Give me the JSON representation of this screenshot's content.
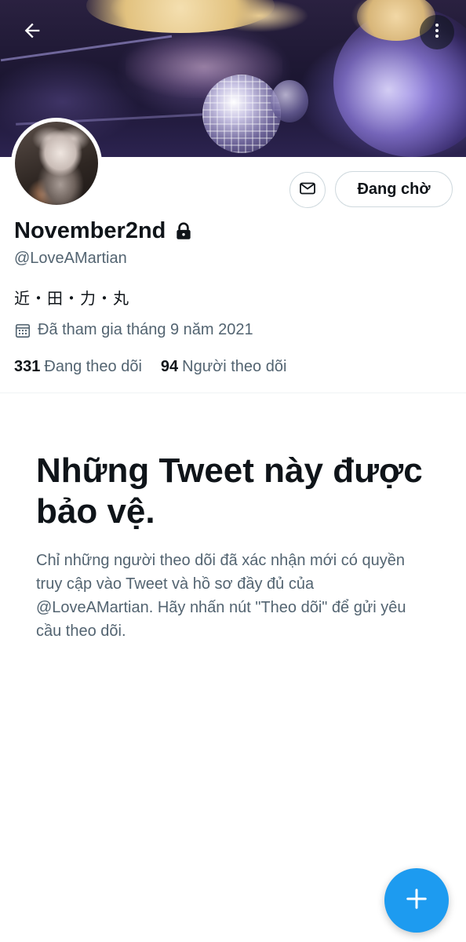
{
  "header": {
    "back_icon": "arrow-left-icon",
    "more_icon": "more-vertical-icon"
  },
  "profile": {
    "display_name": "November2nd",
    "handle": "@LoveAMartian",
    "bio": "近・田・力・丸",
    "joined": "Đã tham gia tháng 9 năm 2021",
    "following_count": "331",
    "following_label": "Đang theo dõi",
    "followers_count": "94",
    "followers_label": "Người theo dõi",
    "protected": true
  },
  "actions": {
    "message_icon": "envelope-icon",
    "pending_label": "Đang chờ"
  },
  "protected_notice": {
    "title": "Những Tweet này được bảo vệ.",
    "body": "Chỉ những người theo dõi đã xác nhận mới có quyền truy cập vào Tweet và hồ sơ đầy đủ của @LoveAMartian. Hãy nhấn nút \"Theo dõi\" để gửi yêu cầu theo dõi."
  },
  "fab": {
    "icon": "plus-icon"
  },
  "colors": {
    "accent": "#1d9bf0",
    "text_primary": "#0f1419",
    "text_secondary": "#536471",
    "border": "#cfd9de"
  }
}
